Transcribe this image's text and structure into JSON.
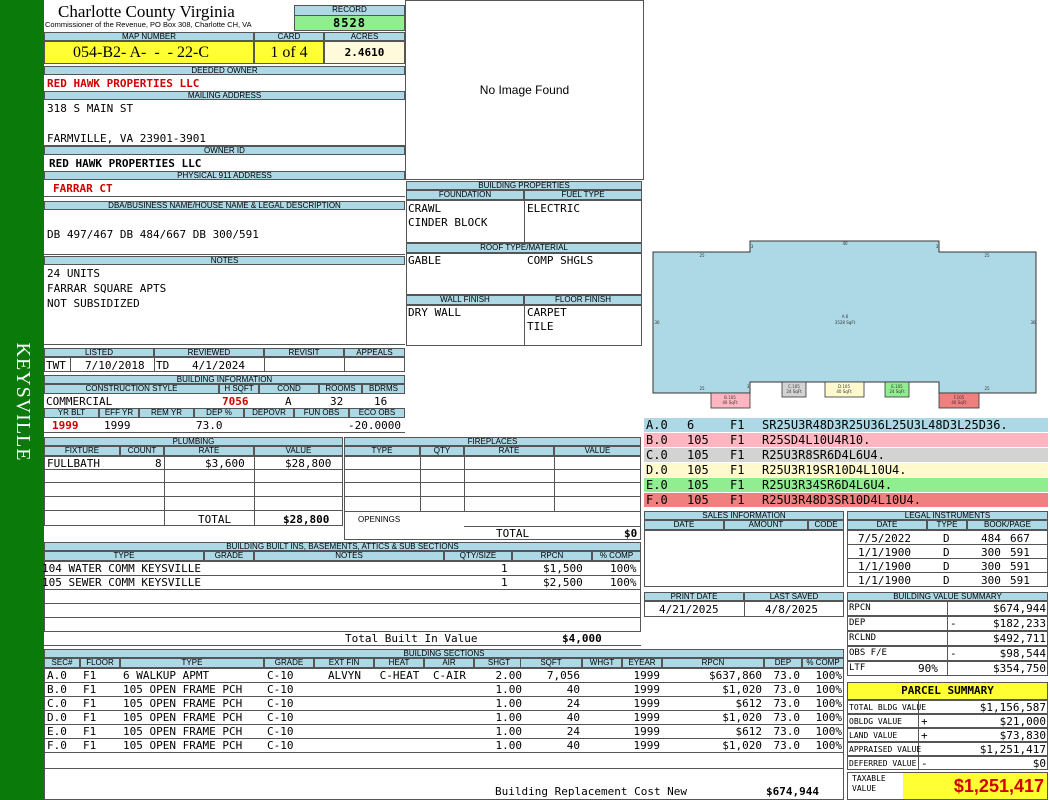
{
  "side_label": "KEYSVILLE",
  "header": {
    "county": "Charlotte County Virginia",
    "commissioner": "Commissioner of the Revenue, PO Box 308, Charlotte CH, VA",
    "record_label": "RECORD",
    "record": "8528"
  },
  "map": {
    "map_label": "MAP NUMBER",
    "map_number": "054-B2- A-  -  - 22-C",
    "card_label": "CARD",
    "card": "1 of 4",
    "acres_label": "ACRES",
    "acres": "2.4610"
  },
  "owner": {
    "deeded_label": "DEEDED OWNER",
    "deeded_owner": "RED HAWK PROPERTIES LLC",
    "mailing_label": "MAILING ADDRESS",
    "addr1": "318 S MAIN ST",
    "addr2": "FARMVILLE, VA 23901-3901",
    "owner_id_label": "OWNER ID",
    "owner_id": "RED HAWK PROPERTIES LLC",
    "phys_label": "PHYSICAL 911 ADDRESS",
    "phys": "FARRAR CT"
  },
  "legal": {
    "label": "DBA/BUSINESS NAME/HOUSE NAME & LEGAL DESCRIPTION",
    "text": "DB 497/467 DB 484/667 DB 300/591"
  },
  "notes": {
    "label": "NOTES",
    "lines": [
      "24 UNITS",
      "FARRAR SQUARE APTS",
      "NOT SUBSIDIZED"
    ]
  },
  "listing": {
    "listed_label": "LISTED",
    "reviewed_label": "REVIEWED",
    "revisit_label": "REVISIT",
    "appeals_label": "APPEALS",
    "listed_by": "TWT",
    "listed_date": "7/10/2018",
    "reviewed_by": "TD",
    "reviewed_date": "4/1/2024"
  },
  "building_info": {
    "label": "BUILDING INFORMATION",
    "cons_label": "CONSTRUCTION STYLE",
    "hsqft_label": "H SQFT",
    "cond_label": "COND",
    "rooms_label": "ROOMS",
    "bdrms_label": "BDRMS",
    "cons": "COMMERCIAL",
    "hsqft": "7056",
    "cond": "A",
    "rooms": "32",
    "bdrms": "16",
    "yrblt_label": "YR BLT",
    "effyr_label": "EFF YR",
    "remyr_label": "REM YR",
    "dep_label": "DEP %",
    "depovr_label": "DEPOVR",
    "funobs_label": "FUN OBS",
    "ecoobs_label": "ECO OBS",
    "yrblt": "1999",
    "effyr": "1999",
    "dep": "73.0",
    "ecoobs": "-20.0000"
  },
  "plumbing": {
    "label": "PLUMBING",
    "cols": [
      "FIXTURE",
      "COUNT",
      "RATE",
      "VALUE"
    ],
    "rows": [
      {
        "fixture": "FULLBATH",
        "count": "8",
        "rate": "$3,600",
        "value": "$28,800"
      }
    ],
    "total_label": "TOTAL",
    "total": "$28,800"
  },
  "fireplaces": {
    "label": "FIREPLACES",
    "cols": [
      "TYPE",
      "QTY",
      "RATE",
      "VALUE"
    ],
    "openings_label": "OPENINGS",
    "total_label": "TOTAL",
    "total": "$0"
  },
  "image": {
    "no_image": "No Image Found"
  },
  "building_props": {
    "label": "BUILDING PROPERTIES",
    "foundation_label": "FOUNDATION",
    "fuel_label": "FUEL TYPE",
    "foundation": [
      "CRAWL",
      "CINDER BLOCK"
    ],
    "fuel": "ELECTRIC",
    "roof_label": "ROOF TYPE/MATERIAL",
    "roof_type": "GABLE",
    "roof_mat": "COMP SHGLS",
    "wall_label": "WALL FINISH",
    "floor_label": "FLOOR FINISH",
    "wall": "DRY WALL",
    "floor": [
      "CARPET",
      "TILE"
    ]
  },
  "sketch": {
    "labels": {
      "main": "A.0\n3528 SqFt",
      "b": "B.105\n40 SqFt",
      "c": "C.105\n24 SqFt",
      "d": "D.105\n40 SqFt",
      "e": "E.105\n24 SqFt",
      "f": "F.105\n40 SqFt"
    },
    "dims": [
      "40",
      "3",
      "25",
      "36",
      "36",
      "25",
      "3",
      "3",
      "25"
    ]
  },
  "sketch_codes": [
    {
      "sec": "A.0",
      "code": "6",
      "floor": "F1",
      "vec": "SR25U3R48D3R25U36L25U3L48D3L25D36.",
      "color": "#add8e6"
    },
    {
      "sec": "B.0",
      "code": "105",
      "floor": "F1",
      "vec": "R25SD4L10U4R10.",
      "color": "#ffb6c1"
    },
    {
      "sec": "C.0",
      "code": "105",
      "floor": "F1",
      "vec": "R25U3R8SR6D4L6U4.",
      "color": "#d3d3d3"
    },
    {
      "sec": "D.0",
      "code": "105",
      "floor": "F1",
      "vec": "R25U3R19SR10D4L10U4.",
      "color": "#fffacd"
    },
    {
      "sec": "E.0",
      "code": "105",
      "floor": "F1",
      "vec": "R25U3R34SR6D4L6U4.",
      "color": "#90ee90"
    },
    {
      "sec": "F.0",
      "code": "105",
      "floor": "F1",
      "vec": "R25U3R48D3SR10D4L10U4.",
      "color": "#f08080"
    }
  ],
  "sales": {
    "label": "SALES INFORMATION",
    "cols": [
      "DATE",
      "AMOUNT",
      "CODE"
    ]
  },
  "legal_instr": {
    "label": "LEGAL INSTRUMENTS",
    "cols": [
      "DATE",
      "TYPE",
      "BOOK/PAGE"
    ],
    "rows": [
      {
        "date": "7/5/2022",
        "type": "D",
        "book": "484",
        "page": "667"
      },
      {
        "date": "1/1/1900",
        "type": "D",
        "book": "300",
        "page": "591"
      },
      {
        "date": "1/1/1900",
        "type": "D",
        "book": "300",
        "page": "591"
      },
      {
        "date": "1/1/1900",
        "type": "D",
        "book": "300",
        "page": "591"
      }
    ]
  },
  "dates": {
    "print_label": "PRINT DATE",
    "saved_label": "LAST SAVED",
    "print": "4/21/2025",
    "saved": "4/8/2025"
  },
  "builtins": {
    "label": "BUILDING BUILT INS, BASEMENTS, ATTICS & SUB SECTIONS",
    "cols": [
      "TYPE",
      "GRADE",
      "NOTES",
      "QTY/SIZE",
      "RPCN",
      "% COMP"
    ],
    "rows": [
      {
        "type": "104 WATER COMM KEYSVILLE",
        "qty": "1",
        "rpcn": "$1,500",
        "comp": "100%"
      },
      {
        "type": "105 SEWER COMM KEYSVILLE",
        "qty": "1",
        "rpcn": "$2,500",
        "comp": "100%"
      }
    ],
    "total_label": "Total Built In Value",
    "total": "$4,000"
  },
  "value_summary": {
    "label": "BUILDING VALUE SUMMARY",
    "rows": [
      {
        "label": "RPCN",
        "sign": "",
        "value": "$674,944"
      },
      {
        "label": "DEP",
        "sign": "-",
        "value": "$182,233"
      },
      {
        "label": "RCLND",
        "sign": "",
        "value": "$492,711"
      },
      {
        "label": "OBS F/E",
        "sign": "-",
        "value": "$98,544"
      },
      {
        "label": "LTF",
        "sign": "90%",
        "value": "$354,750"
      }
    ]
  },
  "sections": {
    "label": "BUILDING SECTIONS",
    "cols": [
      "SEC#",
      "FLOOR",
      "TYPE",
      "GRADE",
      "EXT FIN",
      "HEAT",
      "AIR",
      "SHGT",
      "SQFT",
      "WHGT",
      "EYEAR",
      "RPCN",
      "DEP",
      "% COMP"
    ],
    "rows": [
      {
        "sec": "A.0",
        "floor": "F1",
        "type": "6 WALKUP APMT",
        "grade": "C-10",
        "ext": "ALVYN",
        "heat": "C-HEAT",
        "air": "C-AIR",
        "shgt": "2.00",
        "sqft": "7,056",
        "whgt": "",
        "eyear": "1999",
        "rpcn": "$637,860",
        "dep": "73.0",
        "comp": "100%"
      },
      {
        "sec": "B.0",
        "floor": "F1",
        "type": "105 OPEN FRAME PCH",
        "grade": "C-10",
        "ext": "",
        "heat": "",
        "air": "",
        "shgt": "1.00",
        "sqft": "40",
        "whgt": "",
        "eyear": "1999",
        "rpcn": "$1,020",
        "dep": "73.0",
        "comp": "100%"
      },
      {
        "sec": "C.0",
        "floor": "F1",
        "type": "105 OPEN FRAME PCH",
        "grade": "C-10",
        "ext": "",
        "heat": "",
        "air": "",
        "shgt": "1.00",
        "sqft": "24",
        "whgt": "",
        "eyear": "1999",
        "rpcn": "$612",
        "dep": "73.0",
        "comp": "100%"
      },
      {
        "sec": "D.0",
        "floor": "F1",
        "type": "105 OPEN FRAME PCH",
        "grade": "C-10",
        "ext": "",
        "heat": "",
        "air": "",
        "shgt": "1.00",
        "sqft": "40",
        "whgt": "",
        "eyear": "1999",
        "rpcn": "$1,020",
        "dep": "73.0",
        "comp": "100%"
      },
      {
        "sec": "E.0",
        "floor": "F1",
        "type": "105 OPEN FRAME PCH",
        "grade": "C-10",
        "ext": "",
        "heat": "",
        "air": "",
        "shgt": "1.00",
        "sqft": "24",
        "whgt": "",
        "eyear": "1999",
        "rpcn": "$612",
        "dep": "73.0",
        "comp": "100%"
      },
      {
        "sec": "F.0",
        "floor": "F1",
        "type": "105 OPEN FRAME PCH",
        "grade": "C-10",
        "ext": "",
        "heat": "",
        "air": "",
        "shgt": "1.00",
        "sqft": "40",
        "whgt": "",
        "eyear": "1999",
        "rpcn": "$1,020",
        "dep": "73.0",
        "comp": "100%"
      }
    ],
    "brcn_label": "Building Replacement Cost New",
    "brcn": "$674,944"
  },
  "parcel": {
    "label": "PARCEL SUMMARY",
    "rows": [
      {
        "label": "TOTAL BLDG VALUE",
        "sign": "",
        "value": "$1,156,587"
      },
      {
        "label": "OBLDG VALUE",
        "sign": "+",
        "value": "$21,000"
      },
      {
        "label": "LAND VALUE",
        "sign": "+",
        "value": "$73,830"
      },
      {
        "label": "APPRAISED VALUE",
        "sign": "",
        "value": "$1,251,417"
      },
      {
        "label": "DEFERRED VALUE",
        "sign": "-",
        "value": "$0"
      }
    ],
    "taxable_label": "TAXABLE VALUE",
    "taxable": "$1,251,417"
  }
}
